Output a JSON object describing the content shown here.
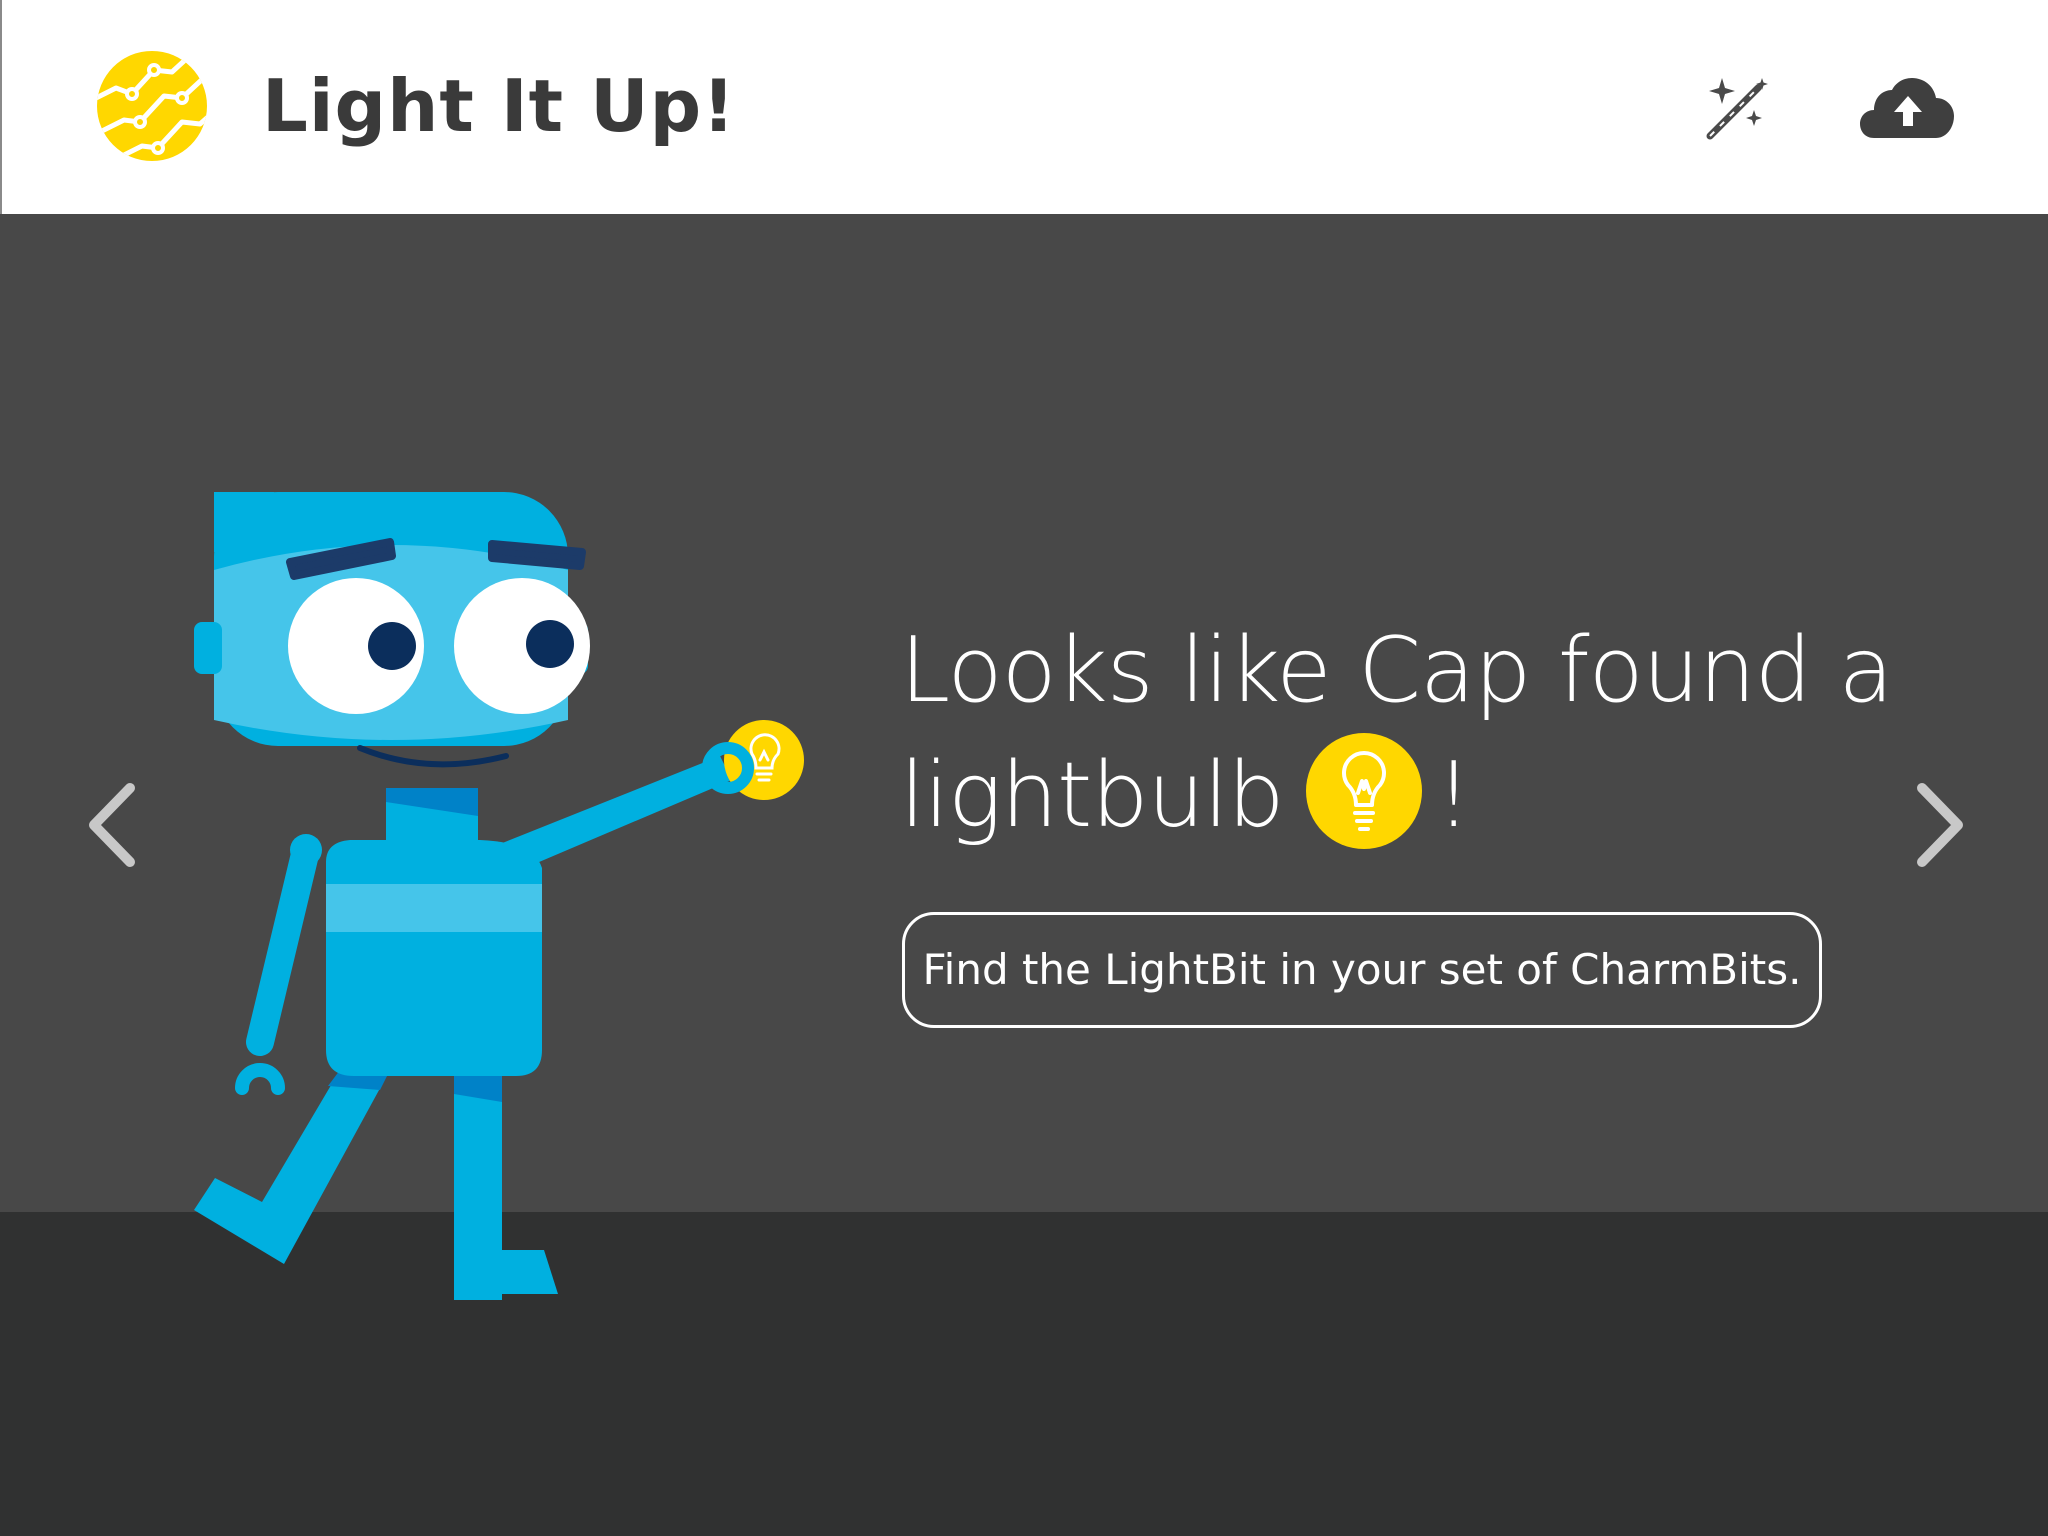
{
  "header": {
    "title": "Light It Up!",
    "logo_icon": "lightning-circuit-logo-icon",
    "actions": [
      {
        "name": "magic-wand-icon"
      },
      {
        "name": "cloud-upload-icon"
      }
    ]
  },
  "content": {
    "headline_line1": "Looks like Cap found a",
    "headline_word": "lightbulb",
    "headline_end": "!",
    "instruction": "Find the LightBit in your set of CharmBits."
  },
  "navigation": {
    "prev_icon": "chevron-left-icon",
    "next_icon": "chevron-right-icon"
  },
  "colors": {
    "header_bg": "#ffffff",
    "stage_bg": "#484848",
    "floor_bg": "#303131",
    "robot_blue": "#00b0e0",
    "robot_light_blue": "#45c5ea",
    "accent_yellow": "#ffd700",
    "title_text": "#3a3a3a"
  }
}
